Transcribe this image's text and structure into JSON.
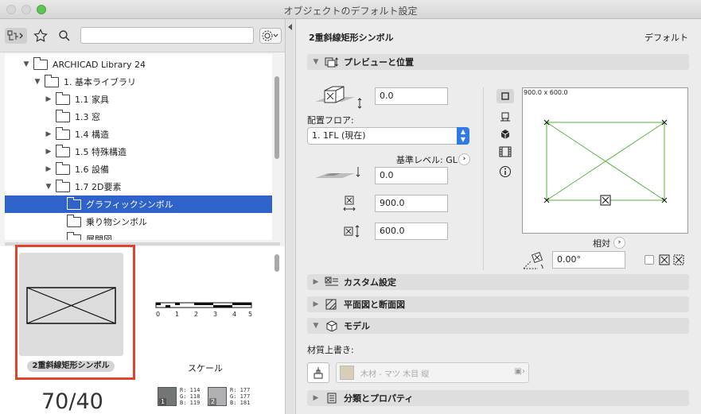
{
  "window": {
    "title": "オブジェクトのデフォルト設定"
  },
  "left_toolbar": {
    "search_value": ""
  },
  "tree": {
    "items": [
      {
        "label": "ARCHICAD Library 24",
        "expanded": true
      },
      {
        "label": "1. 基本ライブラリ",
        "expanded": true
      },
      {
        "label": "1.1 家具",
        "expanded": false
      },
      {
        "label": "1.3 窓",
        "expanded": null
      },
      {
        "label": "1.4 構造",
        "expanded": false
      },
      {
        "label": "1.5 特殊構造",
        "expanded": false
      },
      {
        "label": "1.6 設備",
        "expanded": false
      },
      {
        "label": "1.7 2D要素",
        "expanded": true
      },
      {
        "label": "グラフィックシンボル",
        "selected": true
      },
      {
        "label": "乗り物シンボル"
      },
      {
        "label": "展開図"
      }
    ]
  },
  "library_preview": {
    "object_name": "2重斜線矩形シンボル",
    "scale_label": "スケール",
    "scale_ticks": [
      "0",
      "1",
      "2",
      "3",
      "4",
      "5"
    ],
    "scale_value": "70/40",
    "swatches": [
      {
        "index": "1",
        "rgb": "R: 114\nG: 118\nB: 119",
        "color": "#727677"
      },
      {
        "index": "2",
        "rgb": "R: 177\nG: 177\nB: 181",
        "color": "#b1b1b5"
      }
    ]
  },
  "settings": {
    "object_name": "2重斜線矩形シンボル",
    "default_label": "デフォルト",
    "sections": {
      "preview_position": "プレビューと位置",
      "custom": "カスタム設定",
      "plan_section": "平面図と断面図",
      "model": "モデル",
      "classification": "分類とプロパティ"
    },
    "elevation_value": "0.0",
    "floor_label": "配置フロア:",
    "floor_value": "1. 1FL (現在)",
    "ref_level_label": "基準レベル: GL",
    "ref_level_value": "0.0",
    "width_value": "900.0",
    "depth_value": "600.0",
    "preview_dims": "900.0 x 600.0",
    "relative_label": "相対",
    "angle_value": "0.00°",
    "material_override_label": "材質上書き:",
    "material_value": "木材 - マツ 木目 縦"
  },
  "colors": {
    "selection": "#2f63c9",
    "highlight_frame": "#e0442b",
    "preview_lines": "#57b33a"
  }
}
